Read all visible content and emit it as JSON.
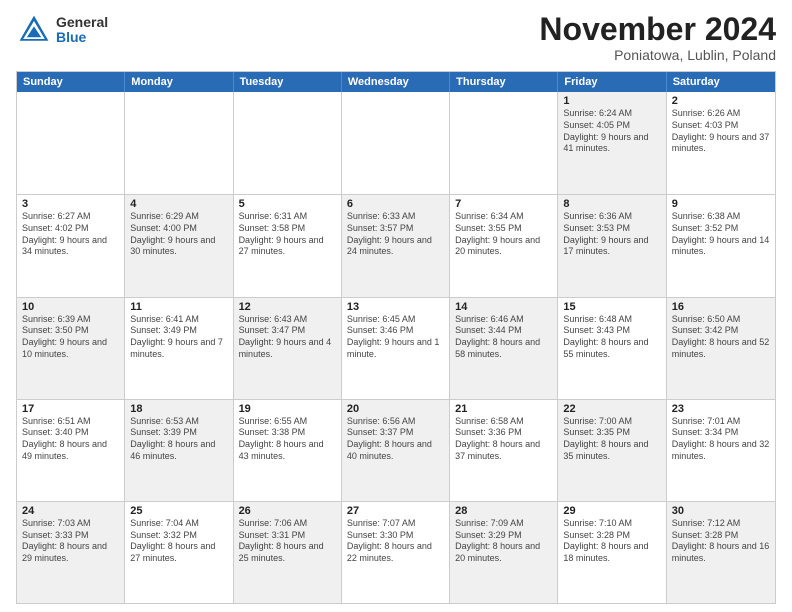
{
  "header": {
    "logo_general": "General",
    "logo_blue": "Blue",
    "title": "November 2024",
    "location": "Poniatowa, Lublin, Poland"
  },
  "weekdays": [
    "Sunday",
    "Monday",
    "Tuesday",
    "Wednesday",
    "Thursday",
    "Friday",
    "Saturday"
  ],
  "rows": [
    [
      {
        "day": "",
        "info": ""
      },
      {
        "day": "",
        "info": ""
      },
      {
        "day": "",
        "info": ""
      },
      {
        "day": "",
        "info": ""
      },
      {
        "day": "",
        "info": ""
      },
      {
        "day": "1",
        "info": "Sunrise: 6:24 AM\nSunset: 4:05 PM\nDaylight: 9 hours and 41 minutes."
      },
      {
        "day": "2",
        "info": "Sunrise: 6:26 AM\nSunset: 4:03 PM\nDaylight: 9 hours and 37 minutes."
      }
    ],
    [
      {
        "day": "3",
        "info": "Sunrise: 6:27 AM\nSunset: 4:02 PM\nDaylight: 9 hours and 34 minutes."
      },
      {
        "day": "4",
        "info": "Sunrise: 6:29 AM\nSunset: 4:00 PM\nDaylight: 9 hours and 30 minutes."
      },
      {
        "day": "5",
        "info": "Sunrise: 6:31 AM\nSunset: 3:58 PM\nDaylight: 9 hours and 27 minutes."
      },
      {
        "day": "6",
        "info": "Sunrise: 6:33 AM\nSunset: 3:57 PM\nDaylight: 9 hours and 24 minutes."
      },
      {
        "day": "7",
        "info": "Sunrise: 6:34 AM\nSunset: 3:55 PM\nDaylight: 9 hours and 20 minutes."
      },
      {
        "day": "8",
        "info": "Sunrise: 6:36 AM\nSunset: 3:53 PM\nDaylight: 9 hours and 17 minutes."
      },
      {
        "day": "9",
        "info": "Sunrise: 6:38 AM\nSunset: 3:52 PM\nDaylight: 9 hours and 14 minutes."
      }
    ],
    [
      {
        "day": "10",
        "info": "Sunrise: 6:39 AM\nSunset: 3:50 PM\nDaylight: 9 hours and 10 minutes."
      },
      {
        "day": "11",
        "info": "Sunrise: 6:41 AM\nSunset: 3:49 PM\nDaylight: 9 hours and 7 minutes."
      },
      {
        "day": "12",
        "info": "Sunrise: 6:43 AM\nSunset: 3:47 PM\nDaylight: 9 hours and 4 minutes."
      },
      {
        "day": "13",
        "info": "Sunrise: 6:45 AM\nSunset: 3:46 PM\nDaylight: 9 hours and 1 minute."
      },
      {
        "day": "14",
        "info": "Sunrise: 6:46 AM\nSunset: 3:44 PM\nDaylight: 8 hours and 58 minutes."
      },
      {
        "day": "15",
        "info": "Sunrise: 6:48 AM\nSunset: 3:43 PM\nDaylight: 8 hours and 55 minutes."
      },
      {
        "day": "16",
        "info": "Sunrise: 6:50 AM\nSunset: 3:42 PM\nDaylight: 8 hours and 52 minutes."
      }
    ],
    [
      {
        "day": "17",
        "info": "Sunrise: 6:51 AM\nSunset: 3:40 PM\nDaylight: 8 hours and 49 minutes."
      },
      {
        "day": "18",
        "info": "Sunrise: 6:53 AM\nSunset: 3:39 PM\nDaylight: 8 hours and 46 minutes."
      },
      {
        "day": "19",
        "info": "Sunrise: 6:55 AM\nSunset: 3:38 PM\nDaylight: 8 hours and 43 minutes."
      },
      {
        "day": "20",
        "info": "Sunrise: 6:56 AM\nSunset: 3:37 PM\nDaylight: 8 hours and 40 minutes."
      },
      {
        "day": "21",
        "info": "Sunrise: 6:58 AM\nSunset: 3:36 PM\nDaylight: 8 hours and 37 minutes."
      },
      {
        "day": "22",
        "info": "Sunrise: 7:00 AM\nSunset: 3:35 PM\nDaylight: 8 hours and 35 minutes."
      },
      {
        "day": "23",
        "info": "Sunrise: 7:01 AM\nSunset: 3:34 PM\nDaylight: 8 hours and 32 minutes."
      }
    ],
    [
      {
        "day": "24",
        "info": "Sunrise: 7:03 AM\nSunset: 3:33 PM\nDaylight: 8 hours and 29 minutes."
      },
      {
        "day": "25",
        "info": "Sunrise: 7:04 AM\nSunset: 3:32 PM\nDaylight: 8 hours and 27 minutes."
      },
      {
        "day": "26",
        "info": "Sunrise: 7:06 AM\nSunset: 3:31 PM\nDaylight: 8 hours and 25 minutes."
      },
      {
        "day": "27",
        "info": "Sunrise: 7:07 AM\nSunset: 3:30 PM\nDaylight: 8 hours and 22 minutes."
      },
      {
        "day": "28",
        "info": "Sunrise: 7:09 AM\nSunset: 3:29 PM\nDaylight: 8 hours and 20 minutes."
      },
      {
        "day": "29",
        "info": "Sunrise: 7:10 AM\nSunset: 3:28 PM\nDaylight: 8 hours and 18 minutes."
      },
      {
        "day": "30",
        "info": "Sunrise: 7:12 AM\nSunset: 3:28 PM\nDaylight: 8 hours and 16 minutes."
      }
    ]
  ],
  "shaded_pattern": [
    [
      false,
      false,
      false,
      false,
      false,
      true,
      false
    ],
    [
      false,
      true,
      false,
      true,
      false,
      true,
      false
    ],
    [
      true,
      false,
      true,
      false,
      true,
      false,
      true
    ],
    [
      false,
      true,
      false,
      true,
      false,
      true,
      false
    ],
    [
      true,
      false,
      true,
      false,
      true,
      false,
      true
    ]
  ]
}
